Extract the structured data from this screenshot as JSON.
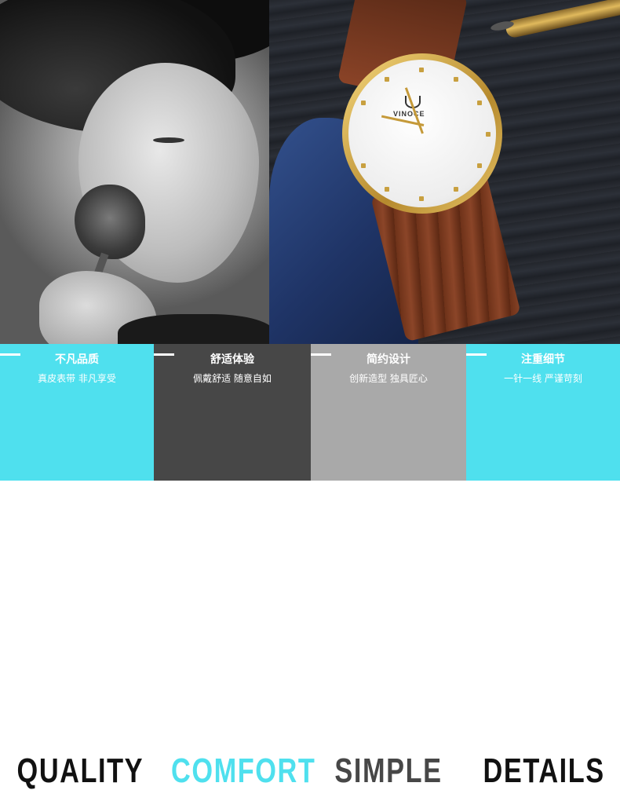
{
  "colors": {
    "cyan": "#4fe0ee",
    "dark_gray": "#474747",
    "light_gray": "#a9a9a9",
    "cyan_text_dark": "#111111"
  },
  "photos": {
    "watch_brand": "VINOCE"
  },
  "features": [
    {
      "title": "QUALITY",
      "line1": "不凡品质",
      "line2": "真皮表带 非凡享受"
    },
    {
      "title": "COMFORT",
      "line1": "舒适体验",
      "line2": "佩戴舒适 随意自如"
    },
    {
      "title": "SIMPLE",
      "line1": "简约设计",
      "line2": "创新造型 独具匠心"
    },
    {
      "title": "DETAILS",
      "line1": "注重细节",
      "line2": "一针一线 严谨苛刻"
    }
  ]
}
